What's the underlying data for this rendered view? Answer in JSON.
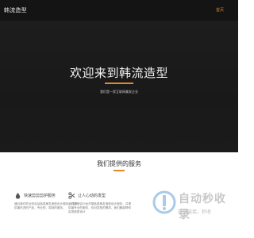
{
  "header": {
    "logo": "韩流造型",
    "nav_home": "首页",
    "accent": "#d9822b"
  },
  "hero": {
    "title": "欢迎来到韩流造型",
    "subtitle": "我们是一家互联网美发企业"
  },
  "services": {
    "title": "我们提供的服务",
    "items": [
      {
        "icon": "drop-icon",
        "title": "快速剪剪剪护服务",
        "desc": "通过我们的业务包括各类美发造型设计服务，并提供最先进的产品，专业的、周到的服务。"
      },
      {
        "icon": "scissors-icon",
        "title": "让人心动的发型",
        "desc": "我们的美容沙龙开展各类美发造型设计服务，并提供最专业的服务，你对发型的需求，我们都能帮你实现造型设计"
      }
    ]
  },
  "watermark": {
    "title": "自动秒收录",
    "subtitle": "提交链接，秒收"
  }
}
